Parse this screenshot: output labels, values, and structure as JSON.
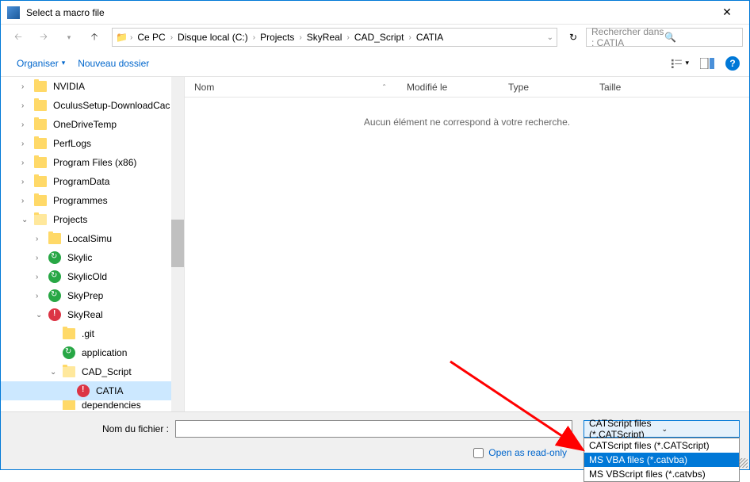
{
  "title": "Select a macro file",
  "breadcrumb": [
    "Ce PC",
    "Disque local (C:)",
    "Projects",
    "SkyReal",
    "CAD_Script",
    "CATIA"
  ],
  "search": {
    "placeholder": "Rechercher dans : CATIA"
  },
  "toolbar": {
    "organize": "Organiser",
    "newfolder": "Nouveau dossier"
  },
  "columns": {
    "name": "Nom",
    "modified": "Modifié le",
    "type": "Type",
    "size": "Taille"
  },
  "empty_message": "Aucun élément ne correspond à votre recherche.",
  "tree": [
    {
      "label": "NVIDIA",
      "depth": 1,
      "icon": "folder"
    },
    {
      "label": "OculusSetup-DownloadCac",
      "depth": 1,
      "icon": "folder"
    },
    {
      "label": "OneDriveTemp",
      "depth": 1,
      "icon": "folder"
    },
    {
      "label": "PerfLogs",
      "depth": 1,
      "icon": "folder"
    },
    {
      "label": "Program Files (x86)",
      "depth": 1,
      "icon": "folder"
    },
    {
      "label": "ProgramData",
      "depth": 1,
      "icon": "folder"
    },
    {
      "label": "Programmes",
      "depth": 1,
      "icon": "folder"
    },
    {
      "label": "Projects",
      "depth": 1,
      "icon": "folder-open",
      "expanded": true
    },
    {
      "label": "LocalSimu",
      "depth": 2,
      "icon": "folder"
    },
    {
      "label": "Skylic",
      "depth": 2,
      "icon": "badge-green"
    },
    {
      "label": "SkylicOld",
      "depth": 2,
      "icon": "badge-green"
    },
    {
      "label": "SkyPrep",
      "depth": 2,
      "icon": "badge-green"
    },
    {
      "label": "SkyReal",
      "depth": 2,
      "icon": "badge-red",
      "expanded": true
    },
    {
      "label": ".git",
      "depth": 3,
      "icon": "folder"
    },
    {
      "label": "application",
      "depth": 3,
      "icon": "badge-green"
    },
    {
      "label": "CAD_Script",
      "depth": 3,
      "icon": "folder-open",
      "expanded": true
    },
    {
      "label": "CATIA",
      "depth": 4,
      "icon": "badge-red",
      "selected": true
    },
    {
      "label": "dependencies",
      "depth": 3,
      "icon": "folder",
      "cut": true
    }
  ],
  "filename": {
    "label": "Nom du fichier :",
    "value": ""
  },
  "filetype": {
    "selected": "CATScript files (*.CATScript)",
    "options": [
      "CATScript files (*.CATScript)",
      "MS VBA files (*.catvba)",
      "MS VBScript files (*.catvbs)"
    ],
    "highlighted_index": 1
  },
  "readonly": {
    "label": "Open as read-only",
    "checked": false
  }
}
